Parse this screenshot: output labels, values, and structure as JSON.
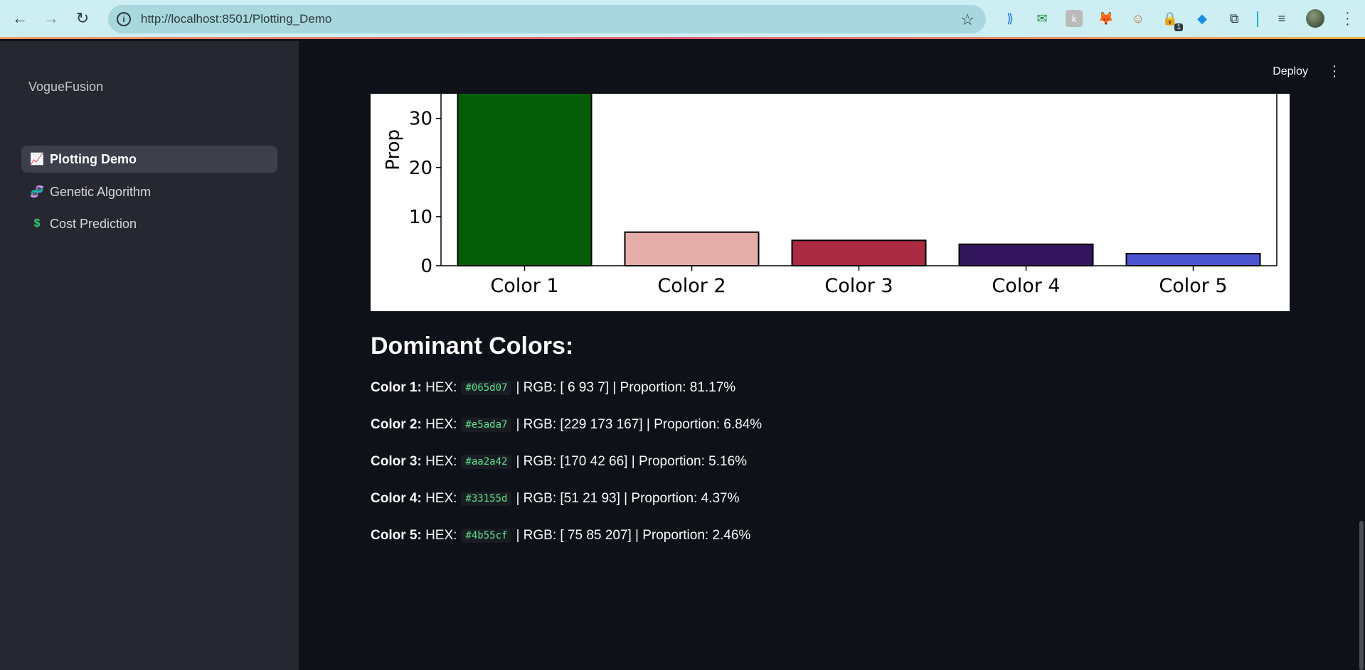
{
  "browser": {
    "url": "http://localhost:8501/Plotting_Demo",
    "extension_badge": "1"
  },
  "sidebar": {
    "brand": "VogueFusion",
    "items": [
      {
        "icon": "📈",
        "label": "Plotting Demo",
        "active": true
      },
      {
        "icon": "🧬",
        "label": "Genetic Algorithm",
        "active": false
      },
      {
        "icon": "$",
        "label": "Cost Prediction",
        "active": false
      }
    ]
  },
  "header": {
    "deploy_label": "Deploy"
  },
  "chart_data": {
    "type": "bar",
    "categories": [
      "Color 1",
      "Color 2",
      "Color 3",
      "Color 4",
      "Color 5"
    ],
    "values": [
      81.17,
      6.84,
      5.16,
      4.37,
      2.46
    ],
    "colors": [
      "#065d07",
      "#e5ada7",
      "#aa2a42",
      "#33155d",
      "#4b55cf"
    ],
    "ylabel": "Prop",
    "yticks": [
      0,
      10,
      20,
      30
    ],
    "ylim_visible": [
      0,
      36
    ]
  },
  "section": {
    "heading": "Dominant Colors:"
  },
  "colors": [
    {
      "label": "Color 1:",
      "hex_label": "HEX:",
      "hex": "#065d07",
      "rgb": "| RGB: [ 6 93 7] | Proportion: 81.17%"
    },
    {
      "label": "Color 2:",
      "hex_label": "HEX:",
      "hex": "#e5ada7",
      "rgb": "| RGB: [229 173 167] | Proportion: 6.84%"
    },
    {
      "label": "Color 3:",
      "hex_label": "HEX:",
      "hex": "#aa2a42",
      "rgb": "| RGB: [170 42 66] | Proportion: 5.16%"
    },
    {
      "label": "Color 4:",
      "hex_label": "HEX:",
      "hex": "#33155d",
      "rgb": "| RGB: [51 21 93] | Proportion: 4.37%"
    },
    {
      "label": "Color 5:",
      "hex_label": "HEX:",
      "hex": "#4b55cf",
      "rgb": "| RGB: [ 75 85 207] | Proportion: 2.46%"
    }
  ]
}
